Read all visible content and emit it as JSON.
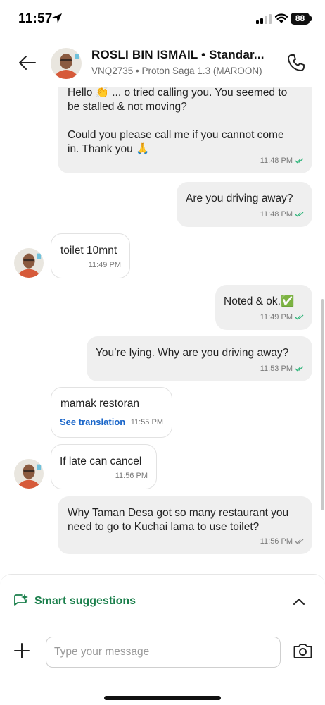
{
  "status_bar": {
    "time": "11:57",
    "battery": "88"
  },
  "header": {
    "name": "ROSLI BIN ISMAIL • Standar...",
    "subtitle": "VNQ2735 • Proton Saga 1.3 (MAROON)"
  },
  "messages": [
    {
      "direction": "outgoing",
      "text": "Hello 👏 ... o tried calling you. You seemed to\nbe stalled & not moving?\n\nCould you please call me if you cannot come\nin. Thank you 🙏",
      "time": "11:48 PM",
      "status": "read"
    },
    {
      "direction": "outgoing",
      "text": "Are you driving away?",
      "time": "11:48 PM",
      "status": "read"
    },
    {
      "direction": "incoming",
      "text": "toilet 10mnt",
      "time": "11:49 PM"
    },
    {
      "direction": "outgoing",
      "text": "Noted & ok.✅",
      "time": "11:49 PM",
      "status": "read"
    },
    {
      "direction": "outgoing",
      "text": "You’re lying. Why are you driving away?",
      "time": "11:53 PM",
      "status": "read"
    },
    {
      "direction": "incoming",
      "text": "mamak restoran",
      "time": "11:55 PM",
      "action": "See translation"
    },
    {
      "direction": "incoming",
      "text": "If late can cancel",
      "time": "11:56 PM"
    },
    {
      "direction": "outgoing",
      "text": "Why Taman Desa got so many restaurant you\nneed to go to Kuchai lama to use toilet?",
      "time": "11:56 PM",
      "status": "delivered"
    }
  ],
  "smart_suggestions": {
    "label": "Smart suggestions",
    "icon": "sparkle-chat-icon"
  },
  "composer": {
    "placeholder": "Type your message",
    "value": ""
  },
  "colors": {
    "accent_green": "#1a7f4b",
    "tick_read": "#2fb57a",
    "tick_delivered": "#8a8a8a",
    "link_blue": "#1a66c9",
    "bubble_out": "#efefef"
  }
}
